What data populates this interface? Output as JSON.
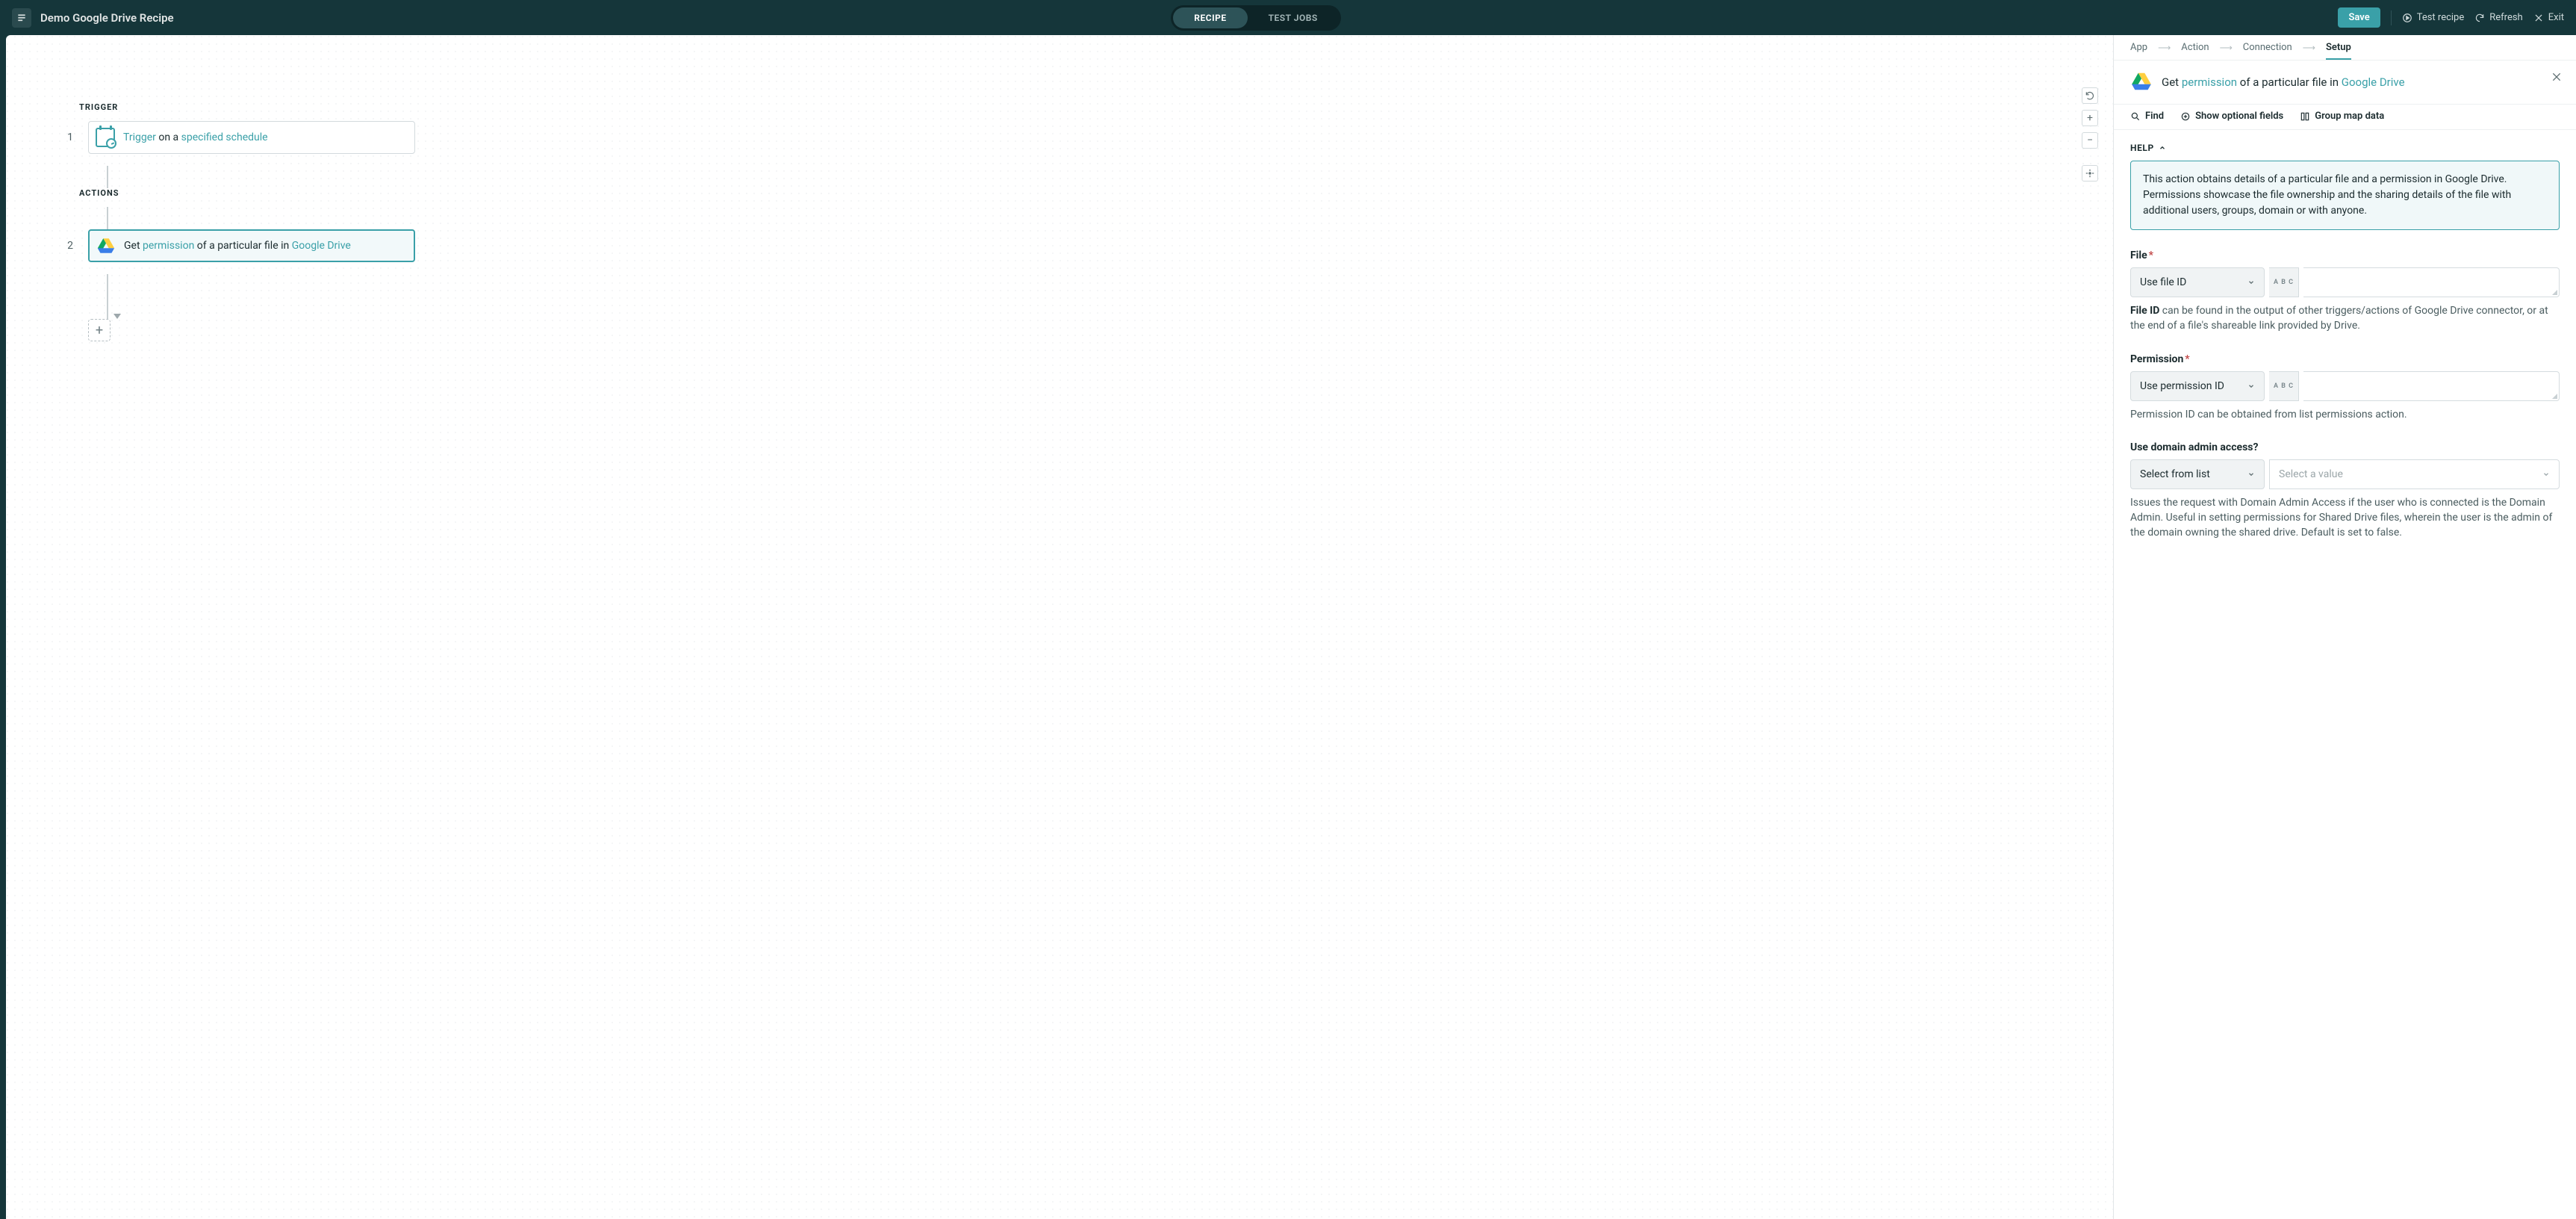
{
  "header": {
    "title": "Demo Google Drive Recipe",
    "tabs": {
      "recipe": "RECIPE",
      "test_jobs": "TEST JOBS"
    },
    "save": "Save",
    "test_recipe": "Test recipe",
    "refresh": "Refresh",
    "exit": "Exit"
  },
  "canvas": {
    "trigger_label": "TRIGGER",
    "actions_label": "ACTIONS",
    "steps": [
      {
        "num": "1",
        "prefix": "Trigger",
        "mid": " on a ",
        "suffix": "specified schedule"
      },
      {
        "num": "2",
        "prefix": "Get ",
        "hl1": "permission",
        "mid": " of a particular file in ",
        "hl2": "Google Drive"
      }
    ]
  },
  "panel": {
    "crumbs": {
      "app": "App",
      "action": "Action",
      "connection": "Connection",
      "setup": "Setup"
    },
    "title_pre": "Get ",
    "title_hl1": "permission",
    "title_mid": " of a particular file in ",
    "title_hl2": "Google Drive",
    "find": "Find",
    "show_optional": "Show optional fields",
    "group_map": "Group map data",
    "help_label": "HELP",
    "help_text": "This action obtains details of a particular file and a permission in Google Drive. Permissions showcase the file ownership and the sharing details of the file with additional users, groups, domain or with anyone.",
    "file": {
      "label": "File",
      "mode": "Use file ID",
      "abc": "A B C",
      "help_bold": "File ID",
      "help_rest": " can be found in the output of other triggers/actions of Google Drive connector, or at the end of a file's shareable link provided by Drive."
    },
    "permission": {
      "label": "Permission",
      "mode": "Use permission ID",
      "abc": "A B C",
      "help": "Permission ID can be obtained from list permissions action."
    },
    "domain_admin": {
      "label": "Use domain admin access?",
      "mode": "Select from list",
      "placeholder": "Select a value",
      "help": "Issues the request with Domain Admin Access if the user who is connected is the Domain Admin. Useful in setting permissions for Shared Drive files, wherein the user is the admin of the domain owning the shared drive. Default is set to false."
    }
  }
}
